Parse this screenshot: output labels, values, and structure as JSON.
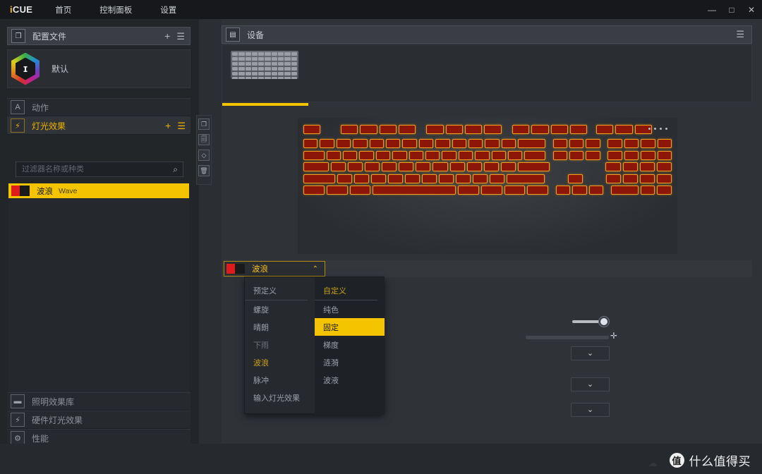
{
  "titlebar": {
    "logo": "iCUE",
    "logo_accent": "i",
    "logo_rest": "CUE",
    "menu": [
      {
        "label": "首页",
        "name": "menu-home"
      },
      {
        "label": "控制面板",
        "name": "menu-dashboard"
      },
      {
        "label": "设置",
        "name": "menu-settings"
      }
    ],
    "window_controls": {
      "minimize": "—",
      "maximize": "□",
      "close": "✕"
    }
  },
  "sidebar": {
    "profiles_panel": {
      "title": "配置文件",
      "icon": "profile-icon",
      "add_label": "+",
      "menu_label": "☰",
      "items": [
        {
          "name": "默认",
          "icon": "icue-hex-logo",
          "logo_letter": "ɪ"
        }
      ]
    },
    "nav": [
      {
        "label": "动作",
        "icon_glyph": "A",
        "active": false,
        "name": "sidebar-item-actions"
      },
      {
        "label": "灯光效果",
        "icon_glyph": "⚡",
        "active": true,
        "name": "sidebar-item-lighting-effects"
      }
    ],
    "search": {
      "placeholder": "过滤器名称或种类",
      "value": "",
      "icon": "search-icon"
    },
    "effects": [
      {
        "name": "波浪",
        "sub": "Wave",
        "selected": true,
        "swatch_left": "#e01b1b",
        "swatch_right": "#1a1a1a"
      }
    ],
    "bottom_nav": [
      {
        "label": "照明效果库",
        "icon_glyph": "▬",
        "name": "sidebar-item-lighting-library"
      },
      {
        "label": "硬件灯光效果",
        "icon_glyph": "⚡",
        "name": "sidebar-item-hardware-lighting"
      },
      {
        "label": "性能",
        "icon_glyph": "⚙",
        "name": "sidebar-item-performance"
      }
    ]
  },
  "icon_strip": [
    {
      "glyph": "❐",
      "name": "copy-icon"
    },
    {
      "glyph": "🗐",
      "name": "paste-icon"
    },
    {
      "glyph": "◇",
      "name": "link-icon"
    },
    {
      "glyph": "🗑",
      "name": "delete-icon"
    }
  ],
  "device_panel": {
    "title": "设备",
    "icon": "keyboard-icon",
    "menu_label": "☰",
    "devices": [
      {
        "name": "keyboard-thumbnail",
        "selected": true
      }
    ]
  },
  "effect_selector": {
    "label": "波浪",
    "chevron": "⌃",
    "swatch_left": "#e01b1b",
    "swatch_right": "#1a1a1a",
    "open": true
  },
  "effect_popup": {
    "columns": [
      {
        "header": "预定义",
        "name": "predefined-column",
        "items": [
          {
            "label": "螺旋",
            "state": "normal"
          },
          {
            "label": "晴朗",
            "state": "normal"
          },
          {
            "label": "下雨",
            "state": "dim"
          },
          {
            "label": "波浪",
            "state": "selected"
          },
          {
            "label": "脉冲",
            "state": "normal"
          },
          {
            "label": "输入灯光效果",
            "state": "normal"
          }
        ]
      },
      {
        "header": "自定义",
        "name": "custom-column",
        "items": [
          {
            "label": "纯色",
            "state": "normal"
          },
          {
            "label": "固定",
            "state": "highlighted"
          },
          {
            "label": "梯度",
            "state": "normal"
          },
          {
            "label": "涟漪",
            "state": "normal"
          },
          {
            "label": "波液",
            "state": "normal"
          }
        ]
      }
    ]
  },
  "controls": {
    "slider": {
      "name": "opacity-slider",
      "value": 100
    },
    "cursor_icon": "✛",
    "selects": [
      {
        "chevron": "⌄",
        "name": "select-1"
      },
      {
        "chevron": "⌄",
        "name": "select-2"
      },
      {
        "chevron": "⌄",
        "name": "select-3"
      }
    ]
  },
  "watermark": {
    "logo": "值",
    "text": "什么值得买"
  },
  "colors": {
    "accent": "#f5c400",
    "accent_text": "#f0c020",
    "bg_dark": "#16181b",
    "bg_panel": "#232629",
    "bg_right": "#2f3338",
    "key_red": "#8c1608",
    "key_glow": "#f0a020"
  }
}
